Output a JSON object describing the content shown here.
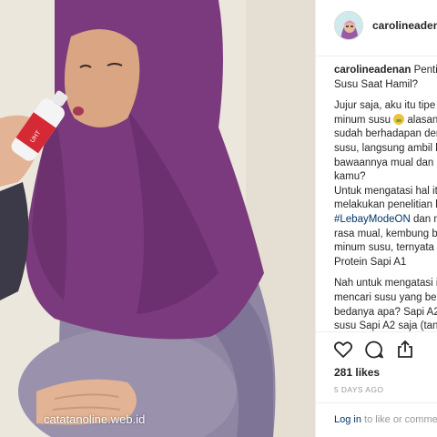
{
  "photo": {
    "watermark": "catatanoline.web.id"
  },
  "header": {
    "username": "carolineadenan"
  },
  "caption": {
    "username": "carolineadenan",
    "title_first": "Penting",
    "title_second": "Susu Saat Hamil?",
    "lines": [
      "Jujur saja, aku itu tipe o",
      "minum susu",
      " alasan",
      "sudah berhadapan den",
      "susu, langsung ambil la",
      "bawaannya mual dan e",
      "kamu?",
      "Untuk mengatasi hal itu",
      "melakukan penelitian b",
      "#LebayModeON",
      " dan m",
      "rasa mual, kembung ba",
      "minum susu, ternyata d",
      "Protein Sapi A1",
      "Nah untuk mengatasi it",
      "mencari susu yang bera",
      "bedanya apa? Sapi A2 i",
      "susu Sapi A2 saja (tanp"
    ]
  },
  "actions": {
    "like_icon": "heart-icon",
    "comment_icon": "comment-icon",
    "share_icon": "share-icon"
  },
  "likes": "281 likes",
  "date": "5 DAYS AGO",
  "login": {
    "link": "Log in",
    "text": " to like or comme"
  },
  "colors": {
    "hijab": "#7b3a7e",
    "link": "#003569",
    "muted": "#999999",
    "text": "#262626"
  }
}
